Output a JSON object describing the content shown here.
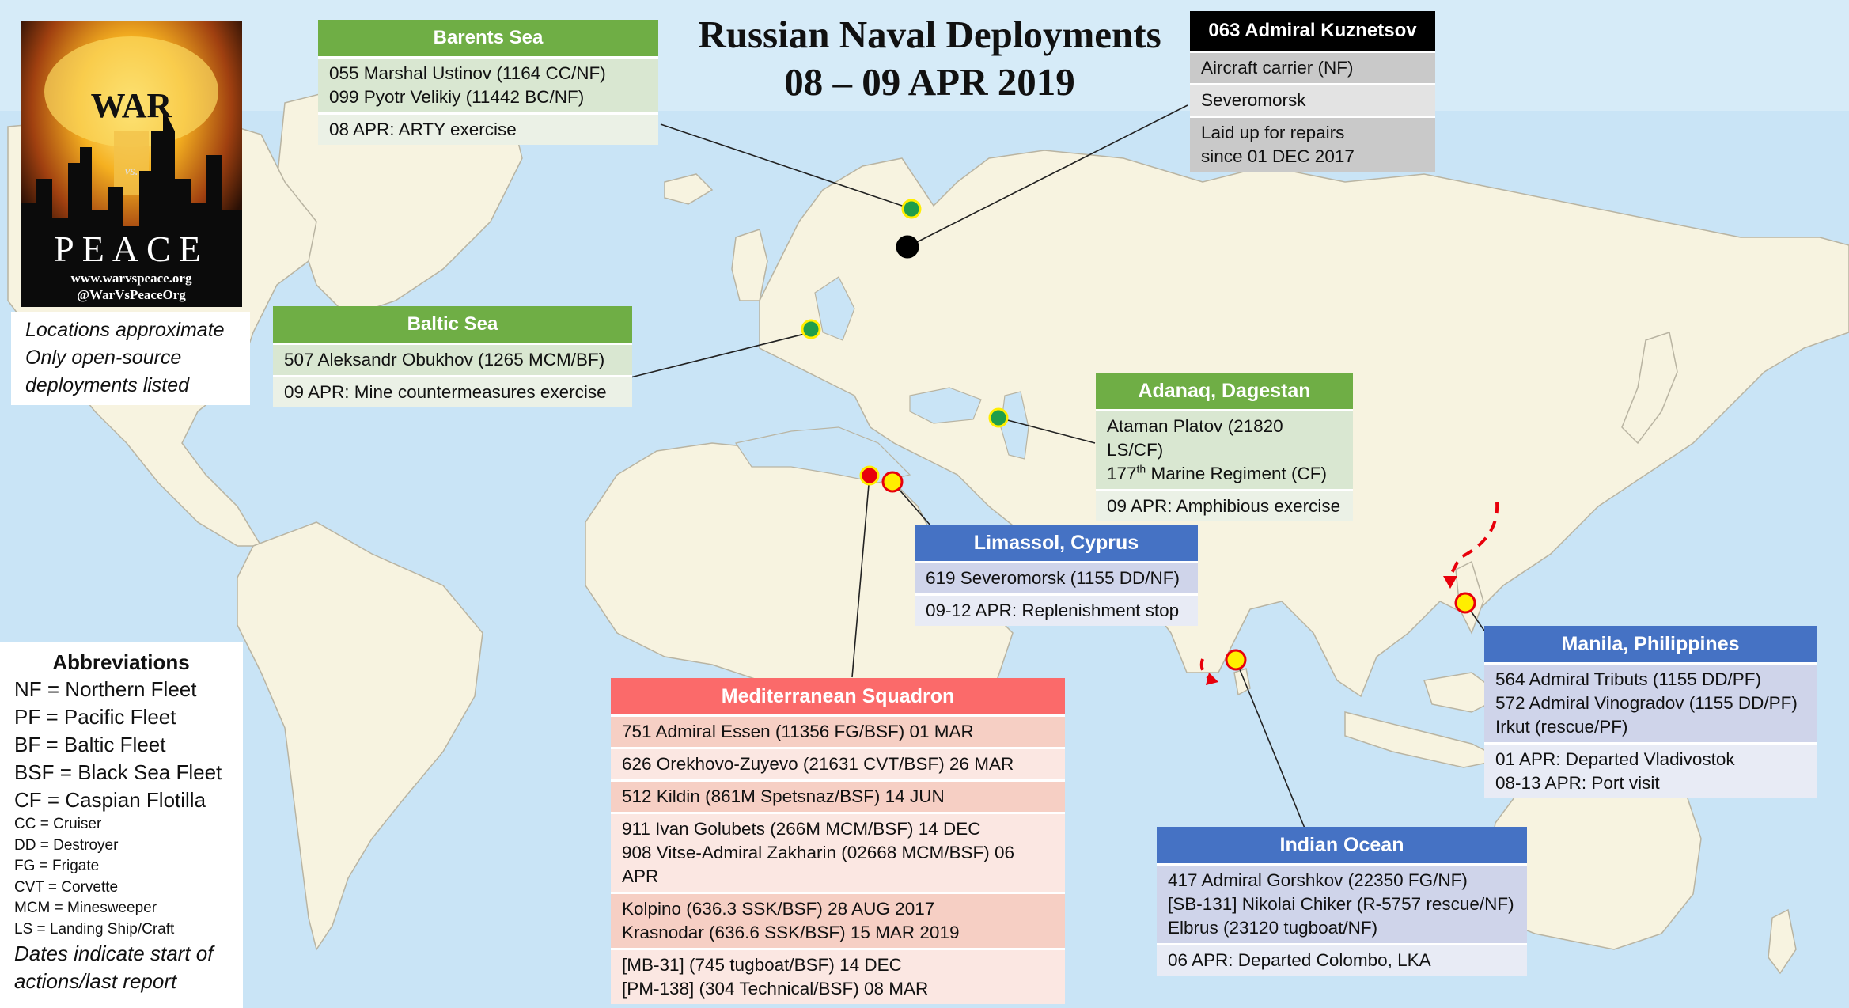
{
  "title": {
    "line1": "Russian Naval Deployments",
    "line2": "08 – 09 APR 2019"
  },
  "logo": {
    "war": "WAR",
    "vs": "vs.",
    "peace": "PEACE",
    "site": "www.warvspeace.org",
    "handle": "@WarVsPeaceOrg"
  },
  "notes": {
    "line1": "Locations approximate",
    "line2": "Only open-source",
    "line3": "deployments listed"
  },
  "abbreviations": {
    "heading": "Abbreviations",
    "major": [
      "NF = Northern Fleet",
      "PF = Pacific Fleet",
      "BF = Baltic Fleet",
      "BSF = Black Sea Fleet",
      "CF = Caspian Flotilla"
    ],
    "minor": [
      "CC = Cruiser",
      "DD = Destroyer",
      "FG = Frigate",
      "CVT = Corvette",
      "MCM = Minesweeper",
      "LS = Landing Ship/Craft"
    ],
    "footer1": "Dates indicate start of",
    "footer2": "actions/last report"
  },
  "barents": {
    "title": "Barents Sea",
    "ship1": "055 Marshal Ustinov (1164 CC/NF)",
    "ship2": "099 Pyotr Velikiy (11442 BC/NF)",
    "activity": "08 APR: ARTY exercise"
  },
  "kuznetsov": {
    "title": "063 Admiral Kuznetsov",
    "type": "Aircraft carrier (NF)",
    "location": "Severomorsk",
    "status1": "Laid up for repairs",
    "status2": "since 01 DEC 2017"
  },
  "baltic": {
    "title": "Baltic Sea",
    "ship1": "507 Aleksandr Obukhov (1265 MCM/BF)",
    "activity": "09 APR: Mine countermeasures exercise"
  },
  "dagestan": {
    "title": "Adanaq, Dagestan",
    "ship1": "Ataman Platov (21820 LS/CF)",
    "ship2_pre": "177",
    "ship2_sup": "th",
    "ship2_post": " Marine Regiment (CF)",
    "activity": "09 APR: Amphibious exercise"
  },
  "limassol": {
    "title": "Limassol, Cyprus",
    "ship1": "619 Severomorsk (1155 DD/NF)",
    "activity": "09-12 APR: Replenishment stop"
  },
  "mediterranean": {
    "title": "Mediterranean Squadron",
    "r1": "751 Admiral Essen (11356 FG/BSF) 01 MAR",
    "r2": "626 Orekhovo-Zuyevo (21631 CVT/BSF) 26 MAR",
    "r3": "512 Kildin (861M Spetsnaz/BSF) 14 JUN",
    "r4a": "911 Ivan Golubets (266M MCM/BSF) 14 DEC",
    "r4b": "908 Vitse-Admiral Zakharin (02668 MCM/BSF) 06 APR",
    "r5a": "Kolpino (636.3 SSK/BSF) 28 AUG 2017",
    "r5b": "Krasnodar (636.6 SSK/BSF) 15 MAR 2019",
    "r6a": "[MB-31] (745 tugboat/BSF) 14 DEC",
    "r6b": "[PM-138] (304 Technical/BSF) 08 MAR"
  },
  "manila": {
    "title": "Manila, Philippines",
    "ship1": "564 Admiral Tributs (1155 DD/PF)",
    "ship2": "572 Admiral Vinogradov (1155 DD/PF)",
    "ship3": "Irkut (rescue/PF)",
    "act1": "01 APR: Departed Vladivostok",
    "act2": "08-13 APR: Port visit"
  },
  "indian": {
    "title": "Indian Ocean",
    "ship1": "417 Admiral Gorshkov (22350 FG/NF)",
    "ship2": "[SB-131] Nikolai Chiker (R-5757 rescue/NF)",
    "ship3": "Elbrus (23120 tugboat/NF)",
    "activity": "06 APR: Departed Colombo, LKA"
  },
  "colors": {
    "ocean": "#c9e4f6",
    "land": "#f7f3e0",
    "green": "#6fae45",
    "blue": "#4572c4",
    "red": "#fb6a6a",
    "marker_green": "#1f9e4a",
    "marker_yellow": "#ffee00",
    "marker_red": "#e8000b"
  }
}
